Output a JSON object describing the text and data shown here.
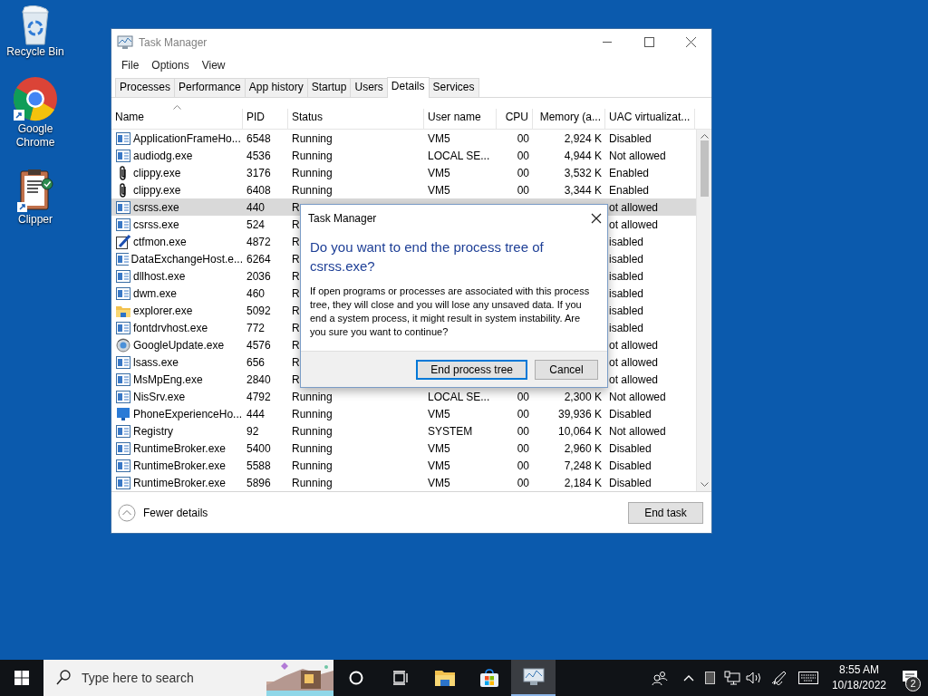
{
  "desktop_icons": [
    {
      "kind": "bin",
      "label": "Recycle Bin"
    },
    {
      "kind": "browser",
      "label": "Google Chrome"
    },
    {
      "kind": "clipboard",
      "label": "Clipper"
    }
  ],
  "window": {
    "title": "Task Manager",
    "menu": [
      "File",
      "Options",
      "View"
    ],
    "tabs": [
      {
        "label": "Processes",
        "selected": false
      },
      {
        "label": "Performance",
        "selected": false
      },
      {
        "label": "App history",
        "selected": false
      },
      {
        "label": "Startup",
        "selected": false
      },
      {
        "label": "Users",
        "selected": false
      },
      {
        "label": "Details",
        "selected": true
      },
      {
        "label": "Services",
        "selected": false
      }
    ],
    "table": {
      "columns": [
        {
          "label": "Name",
          "sorted": true
        },
        {
          "label": "PID",
          "sorted": false
        },
        {
          "label": "Status",
          "sorted": false
        },
        {
          "label": "User name",
          "sorted": false
        },
        {
          "label": "CPU",
          "sorted": false
        },
        {
          "label": "Memory (a...",
          "sorted": false
        },
        {
          "label": "UAC virtualizat...",
          "sorted": false
        }
      ],
      "rows": [
        {
          "kind": "app",
          "name": "ApplicationFrameHo...",
          "pid": "6548",
          "status": "Running",
          "user": "VM5",
          "cpu": "00",
          "memory": "2,924 K",
          "uac": "Disabled",
          "selected": false
        },
        {
          "kind": "app",
          "name": "audiodg.exe",
          "pid": "4536",
          "status": "Running",
          "user": "LOCAL SE...",
          "cpu": "00",
          "memory": "4,944 K",
          "uac": "Not allowed",
          "selected": false
        },
        {
          "kind": "clip",
          "name": "clippy.exe",
          "pid": "3176",
          "status": "Running",
          "user": "VM5",
          "cpu": "00",
          "memory": "3,532 K",
          "uac": "Enabled",
          "selected": false
        },
        {
          "kind": "clip",
          "name": "clippy.exe",
          "pid": "6408",
          "status": "Running",
          "user": "VM5",
          "cpu": "00",
          "memory": "3,344 K",
          "uac": "Enabled",
          "selected": false
        },
        {
          "kind": "app",
          "name": "csrss.exe",
          "pid": "440",
          "status": "R",
          "uac": "ot allowed",
          "selected": true
        },
        {
          "kind": "app",
          "name": "csrss.exe",
          "pid": "524",
          "status": "R",
          "uac": "ot allowed",
          "selected": false
        },
        {
          "kind": "pen",
          "name": "ctfmon.exe",
          "pid": "4872",
          "status": "R",
          "uac": "isabled",
          "selected": false
        },
        {
          "kind": "app",
          "name": "DataExchangeHost.e...",
          "pid": "6264",
          "status": "R",
          "uac": "isabled",
          "selected": false
        },
        {
          "kind": "app",
          "name": "dllhost.exe",
          "pid": "2036",
          "status": "R",
          "uac": "isabled",
          "selected": false
        },
        {
          "kind": "app",
          "name": "dwm.exe",
          "pid": "460",
          "status": "R",
          "uac": "isabled",
          "selected": false
        },
        {
          "kind": "folder",
          "name": "explorer.exe",
          "pid": "5092",
          "status": "R",
          "uac": "isabled",
          "selected": false
        },
        {
          "kind": "app",
          "name": "fontdrvhost.exe",
          "pid": "772",
          "status": "R",
          "uac": "isabled",
          "selected": false
        },
        {
          "kind": "update",
          "name": "GoogleUpdate.exe",
          "pid": "4576",
          "status": "R",
          "uac": "ot allowed",
          "selected": false
        },
        {
          "kind": "app",
          "name": "lsass.exe",
          "pid": "656",
          "status": "R",
          "uac": "ot allowed",
          "selected": false
        },
        {
          "kind": "app",
          "name": "MsMpEng.exe",
          "pid": "2840",
          "status": "R",
          "uac": "ot allowed",
          "selected": false
        },
        {
          "kind": "app",
          "name": "NisSrv.exe",
          "pid": "4792",
          "status": "Running",
          "user": "LOCAL SE...",
          "cpu": "00",
          "memory": "2,300 K",
          "uac": "Not allowed",
          "selected": false
        },
        {
          "kind": "monitor",
          "name": "PhoneExperienceHo...",
          "pid": "444",
          "status": "Running",
          "user": "VM5",
          "cpu": "00",
          "memory": "39,936 K",
          "uac": "Disabled",
          "selected": false
        },
        {
          "kind": "app",
          "name": "Registry",
          "pid": "92",
          "status": "Running",
          "user": "SYSTEM",
          "cpu": "00",
          "memory": "10,064 K",
          "uac": "Not allowed",
          "selected": false
        },
        {
          "kind": "app",
          "name": "RuntimeBroker.exe",
          "pid": "5400",
          "status": "Running",
          "user": "VM5",
          "cpu": "00",
          "memory": "2,960 K",
          "uac": "Disabled",
          "selected": false
        },
        {
          "kind": "app",
          "name": "RuntimeBroker.exe",
          "pid": "5588",
          "status": "Running",
          "user": "VM5",
          "cpu": "00",
          "memory": "7,248 K",
          "uac": "Disabled",
          "selected": false
        },
        {
          "kind": "app",
          "name": "RuntimeBroker.exe",
          "pid": "5896",
          "status": "Running",
          "user": "VM5",
          "cpu": "00",
          "memory": "2,184 K",
          "uac": "Disabled",
          "selected": false
        }
      ]
    },
    "fewer_details": "Fewer details",
    "end_task": "End task"
  },
  "dialog": {
    "title": "Task Manager",
    "heading": "Do you want to end the process tree of csrss.exe?",
    "message": "If open programs or processes are associated with this process tree, they will close and you will lose any unsaved data. If you end a system process, it might result in system instability. Are you sure you want to continue?",
    "buttons": [
      {
        "label": "End process tree",
        "default": true
      },
      {
        "label": "Cancel",
        "default": false
      }
    ]
  },
  "taskbar": {
    "search_placeholder": "Type here to search",
    "apps": [
      {
        "kind": "folder",
        "active": false
      },
      {
        "kind": "store",
        "active": false
      },
      {
        "kind": "taskmgr",
        "active": true
      }
    ],
    "time": "8:55 AM",
    "date": "10/18/2022",
    "notifications": "2"
  }
}
